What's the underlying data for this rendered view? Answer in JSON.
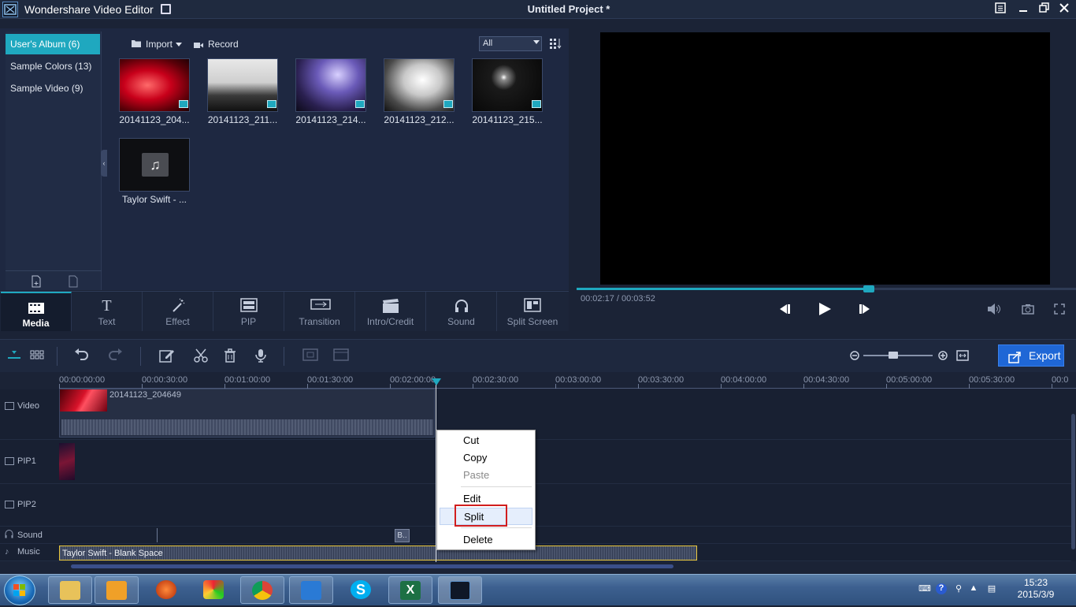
{
  "titlebar": {
    "app_title": "Wondershare Video Editor",
    "project_title": "Untitled Project *"
  },
  "albums": [
    {
      "label": "User's Album (6)",
      "selected": true
    },
    {
      "label": "Sample Colors (13)",
      "selected": false
    },
    {
      "label": "Sample Video (9)",
      "selected": false
    }
  ],
  "media_toolbar": {
    "import_label": "Import",
    "record_label": "Record",
    "filter_value": "All"
  },
  "media_items": [
    {
      "name": "20141123_204...",
      "thumb": "red-abstract",
      "type": "video"
    },
    {
      "name": "20141123_211...",
      "thumb": "stage-bw",
      "type": "video"
    },
    {
      "name": "20141123_214...",
      "thumb": "stage-purple",
      "type": "video"
    },
    {
      "name": "20141123_212...",
      "thumb": "stage-silhouette",
      "type": "video"
    },
    {
      "name": "20141123_215...",
      "thumb": "dark-stage",
      "type": "video"
    },
    {
      "name": "Taylor Swift - ...",
      "thumb": "music-note",
      "type": "audio"
    }
  ],
  "tabs": [
    {
      "label": "Media",
      "icon": "film-icon",
      "active": true
    },
    {
      "label": "Text",
      "icon": "text-icon",
      "active": false
    },
    {
      "label": "Effect",
      "icon": "magic-wand-icon",
      "active": false
    },
    {
      "label": "PIP",
      "icon": "pip-icon",
      "active": false
    },
    {
      "label": "Transition",
      "icon": "transition-icon",
      "active": false
    },
    {
      "label": "Intro/Credit",
      "icon": "clapper-icon",
      "active": false
    },
    {
      "label": "Sound",
      "icon": "headphones-icon",
      "active": false
    },
    {
      "label": "Split Screen",
      "icon": "split-screen-icon",
      "active": false
    }
  ],
  "preview": {
    "timecode": "00:02:17 / 00:03:52",
    "progress": 0.585
  },
  "timeline": {
    "export_label": "Export",
    "ruler": [
      "00:00:00:00",
      "00:00:30:00",
      "00:01:00:00",
      "00:01:30:00",
      "00:02:00:00",
      "00:02:30:00",
      "00:03:00:00",
      "00:03:30:00",
      "00:04:00:00",
      "00:04:30:00",
      "00:05:00:00",
      "00:05:30:00",
      "00:0"
    ],
    "tracks": [
      "Video",
      "PIP1",
      "PIP2",
      "Sound",
      "Music"
    ],
    "video_clip": "20141123_204649",
    "music_clip": "Taylor Swift - Blank Space",
    "sound_marker": "B.."
  },
  "context_menu": [
    {
      "label": "Cut",
      "disabled": false
    },
    {
      "label": "Copy",
      "disabled": false
    },
    {
      "label": "Paste",
      "disabled": true
    },
    {
      "label": "Edit",
      "disabled": false
    },
    {
      "label": "Split",
      "disabled": false,
      "hover": true
    },
    {
      "label": "Delete",
      "disabled": false
    }
  ],
  "taskbar": {
    "time": "15:23",
    "date": "2015/3/9",
    "apps": [
      "file-explorer",
      "outlook",
      "app-orange",
      "app-color",
      "chrome",
      "lync",
      "skype",
      "excel",
      "video-editor"
    ]
  },
  "colors": {
    "accent": "#1fa8bf",
    "export": "#1f67d6",
    "highlight": "#d11e1e",
    "music_border": "#e8c53a"
  }
}
